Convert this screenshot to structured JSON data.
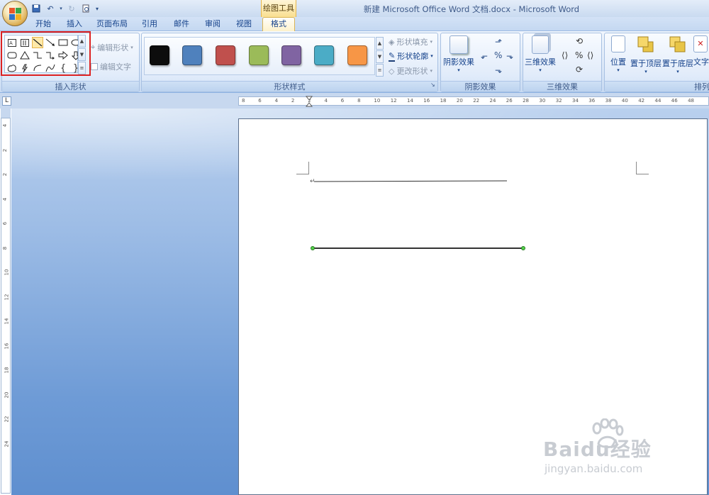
{
  "window": {
    "title": "新建 Microsoft Office Word 文档.docx - Microsoft Word"
  },
  "qat": {
    "items": [
      "save-icon",
      "undo-icon",
      "redo-icon",
      "print-preview-icon",
      "customize-icon"
    ]
  },
  "contextual": {
    "label": "绘图工具"
  },
  "tabs": [
    "开始",
    "插入",
    "页面布局",
    "引用",
    "邮件",
    "审阅",
    "视图",
    "格式"
  ],
  "groups": {
    "insert_shapes": {
      "label": "插入形状",
      "edit_shape": "编辑形状",
      "edit_text": "编辑文字"
    },
    "shape_styles": {
      "label": "形状样式",
      "fill": "形状填充",
      "outline": "形状轮廓",
      "change": "更改形状"
    },
    "shadow": {
      "label": "阴影效果",
      "button": "阴影效果"
    },
    "threed": {
      "label": "三维效果",
      "button": "三维效果"
    },
    "arrange": {
      "label": "排列",
      "position": "位置",
      "front": "置于顶层",
      "back": "置于底层",
      "text": "文字"
    }
  },
  "shape_gallery": [
    "textbox-icon",
    "vertical-textbox-icon",
    "line-icon",
    "arrow-line-icon",
    "rectangle-icon",
    "oval-icon",
    "rounded-rectangle-icon",
    "triangle-icon",
    "elbow-connector-icon",
    "elbow-arrow-icon",
    "right-arrow-icon",
    "down-arrow-icon",
    "freeform-icon",
    "lightning-icon",
    "arc-icon",
    "curve-icon",
    "left-brace-icon",
    "right-brace-icon"
  ],
  "style_colors": [
    "#0d0d0d",
    "#4f81bd",
    "#c0504d",
    "#9bbb59",
    "#8064a2",
    "#4bacc6",
    "#f79646"
  ],
  "ruler": {
    "h_ticks": [
      "8",
      "6",
      "4",
      "2",
      "2",
      "4",
      "6",
      "8",
      "10",
      "12",
      "14",
      "16",
      "18",
      "20",
      "22",
      "24",
      "26",
      "28",
      "30",
      "32",
      "34",
      "36",
      "38",
      "40",
      "42",
      "44",
      "46",
      "48"
    ],
    "v_ticks": [
      "4",
      "2",
      "2",
      "4",
      "6",
      "8",
      "10",
      "12",
      "14",
      "16",
      "18",
      "20",
      "22",
      "24"
    ]
  },
  "watermark": {
    "brand": "Baidu经验",
    "url": "jingyan.baidu.com"
  }
}
